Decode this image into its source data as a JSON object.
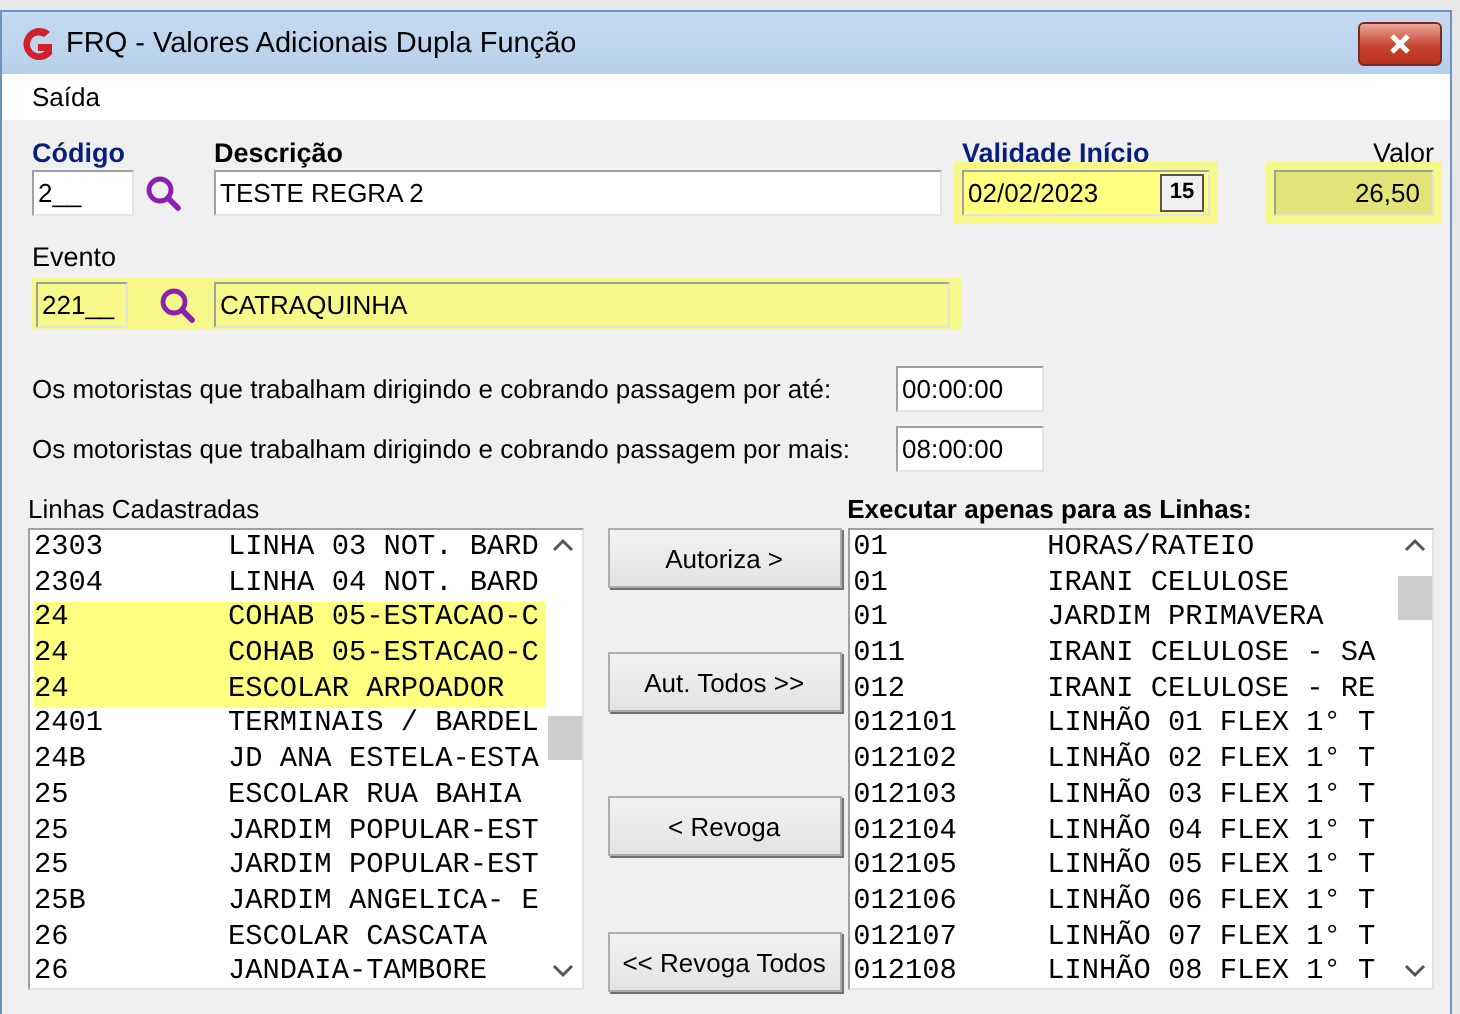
{
  "window": {
    "title": "FRQ - Valores Adicionais Dupla Função"
  },
  "menu": [
    {
      "label": "Saída"
    }
  ],
  "header_fields": [
    {
      "kind": "code",
      "label": "Código",
      "required": true,
      "value": "2__",
      "highlighted": false
    },
    {
      "kind": "text",
      "label": "Descrição",
      "required": false,
      "value": "TESTE REGRA 2",
      "highlighted": false
    },
    {
      "kind": "date",
      "label": "Validade Início",
      "required": true,
      "value": "02/02/2023",
      "calendar_button": "15",
      "highlighted": true
    },
    {
      "kind": "number",
      "label": "Valor",
      "required": false,
      "value": "26,50",
      "highlighted": true
    }
  ],
  "evento": {
    "label": "Evento",
    "code": "221__",
    "name": "CATRAQUINHA",
    "highlighted": true
  },
  "limits": [
    {
      "text": "Os motoristas que trabalham dirigindo e cobrando passagem por até:",
      "value": "00:00:00"
    },
    {
      "text": "Os motoristas que trabalham dirigindo e cobrando passagem por mais:",
      "value": "08:00:00"
    }
  ],
  "available_lines": {
    "title": "Linhas Cadastradas",
    "rows": [
      {
        "code": "2303",
        "name": "LINHA 03 NOT. BARD",
        "highlighted": false
      },
      {
        "code": "2304",
        "name": "LINHA 04 NOT. BARD",
        "highlighted": false
      },
      {
        "code": "24",
        "name": "COHAB 05-ESTACAO-C",
        "highlighted": true
      },
      {
        "code": "24",
        "name": "COHAB 05-ESTACAO-C",
        "highlighted": true
      },
      {
        "code": "24",
        "name": "ESCOLAR ARPOADOR",
        "highlighted": true
      },
      {
        "code": "2401",
        "name": "TERMINAIS / BARDEL",
        "highlighted": false
      },
      {
        "code": "24B",
        "name": "JD ANA ESTELA-ESTA",
        "highlighted": false
      },
      {
        "code": "25",
        "name": "ESCOLAR RUA BAHIA",
        "highlighted": false
      },
      {
        "code": "25",
        "name": "JARDIM POPULAR-EST",
        "highlighted": false
      },
      {
        "code": "25",
        "name": "JARDIM POPULAR-EST",
        "highlighted": false
      },
      {
        "code": "25B",
        "name": "JARDIM ANGELICA- E",
        "highlighted": false
      },
      {
        "code": "26",
        "name": "ESCOLAR CASCATA",
        "highlighted": false
      },
      {
        "code": "26",
        "name": "JANDAIA-TAMBORE",
        "highlighted": false
      }
    ]
  },
  "actions": [
    {
      "label": "Autoriza >"
    },
    {
      "label": "Aut. Todos >>"
    },
    {
      "label": "< Revoga"
    },
    {
      "label": "<< Revoga Todos"
    }
  ],
  "authorized_lines": {
    "title": "Executar apenas para as Linhas:",
    "rows": [
      {
        "code": "01",
        "name": "HORAS/RATEIO",
        "highlighted": false
      },
      {
        "code": "01",
        "name": "IRANI CELULOSE",
        "highlighted": false
      },
      {
        "code": "01",
        "name": "JARDIM PRIMAVERA",
        "highlighted": false
      },
      {
        "code": "011",
        "name": "IRANI CELULOSE - SA",
        "highlighted": false
      },
      {
        "code": "012",
        "name": "IRANI CELULOSE - RE",
        "highlighted": false
      },
      {
        "code": "012101",
        "name": "LINHÃO 01 FLEX 1° T",
        "highlighted": false
      },
      {
        "code": "012102",
        "name": "LINHÃO 02 FLEX 1° T",
        "highlighted": false
      },
      {
        "code": "012103",
        "name": "LINHÃO 03 FLEX 1° T",
        "highlighted": false
      },
      {
        "code": "012104",
        "name": "LINHÃO 04 FLEX 1° T",
        "highlighted": false
      },
      {
        "code": "012105",
        "name": "LINHÃO 05 FLEX 1° T",
        "highlighted": false
      },
      {
        "code": "012106",
        "name": "LINHÃO 06 FLEX 1° T",
        "highlighted": false
      },
      {
        "code": "012107",
        "name": "LINHÃO 07 FLEX 1° T",
        "highlighted": false
      },
      {
        "code": "012108",
        "name": "LINHÃO 08 FLEX 1° T",
        "highlighted": false
      }
    ]
  }
}
